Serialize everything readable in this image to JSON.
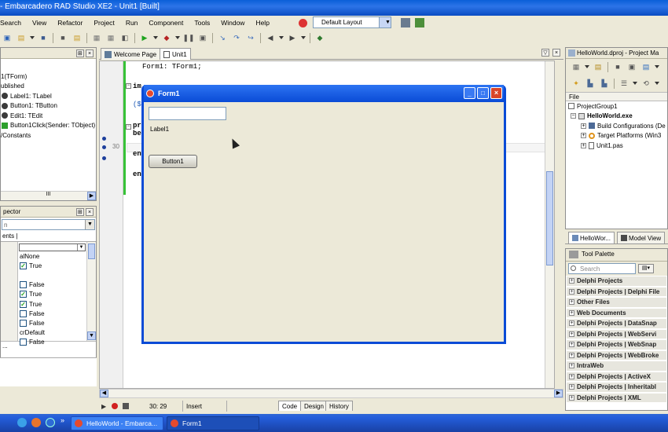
{
  "window": {
    "title": "- Embarcadero RAD Studio XE2 - Unit1 [Built]"
  },
  "menu": [
    "Search",
    "View",
    "Refactor",
    "Project",
    "Run",
    "Component",
    "Tools",
    "Window",
    "Help"
  ],
  "layout": {
    "value": "Default Layout"
  },
  "structure": {
    "items": [
      "1(TForm)",
      "ublished",
      "Label1: TLabel",
      "Button1: TButton",
      "Edit1: TEdit",
      "Button1Click(Sender: TObject)",
      "/Constants"
    ],
    "scroll_label": "III"
  },
  "inspector": {
    "title": "pector",
    "search_value": "n",
    "tabs_label": "ents |",
    "rows": [
      {
        "value": "alNone",
        "check": false
      },
      {
        "value": "True",
        "check": true
      },
      {
        "value": "",
        "check": false
      },
      {
        "value": "False",
        "check": false
      },
      {
        "value": "True",
        "check": true
      },
      {
        "value": "True",
        "check": true
      },
      {
        "value": "False",
        "check": false
      },
      {
        "value": "False",
        "check": false
      },
      {
        "value": "crDefault",
        "check": false
      },
      {
        "value": "False",
        "check": false
      }
    ],
    "footer": "..."
  },
  "editor": {
    "tabs": [
      "Welcome Page",
      "Unit1"
    ],
    "code_line1": "Form1: TForm1;",
    "partials": [
      "im",
      "($",
      "pr",
      "be",
      "en",
      "en"
    ],
    "gutter_number": "30"
  },
  "form": {
    "title": "Form1",
    "label": "Label1",
    "button": "Button1",
    "edit_value": ""
  },
  "status": {
    "position": "30: 29",
    "mode": "Insert",
    "tabs": [
      "Code",
      "Design",
      "History"
    ]
  },
  "project": {
    "title": "HelloWorld.dproj - Project Ma",
    "column": "File",
    "tree": [
      "ProjectGroup1",
      "HelloWorld.exe",
      "Build Configurations (De",
      "Target Platforms (Win3",
      "Unit1.pas"
    ],
    "tabs": [
      "HelloWor...",
      "Model View"
    ]
  },
  "palette": {
    "title": "Tool Palette",
    "search_placeholder": "Search",
    "groups": [
      "Delphi Projects",
      "Delphi Projects | Delphi File",
      "Other Files",
      "Web Documents",
      "Delphi Projects | DataSnap",
      "Delphi Projects | WebServi",
      "Delphi Projects | WebSnap",
      "Delphi Projects | WebBroke",
      "IntraWeb",
      "Delphi Projects | ActiveX",
      "Delphi Projects | Inheritabl",
      "Delphi Projects | XML"
    ]
  },
  "taskbar": {
    "items": [
      "HelloWorld - Embarca...",
      "Form1"
    ]
  }
}
